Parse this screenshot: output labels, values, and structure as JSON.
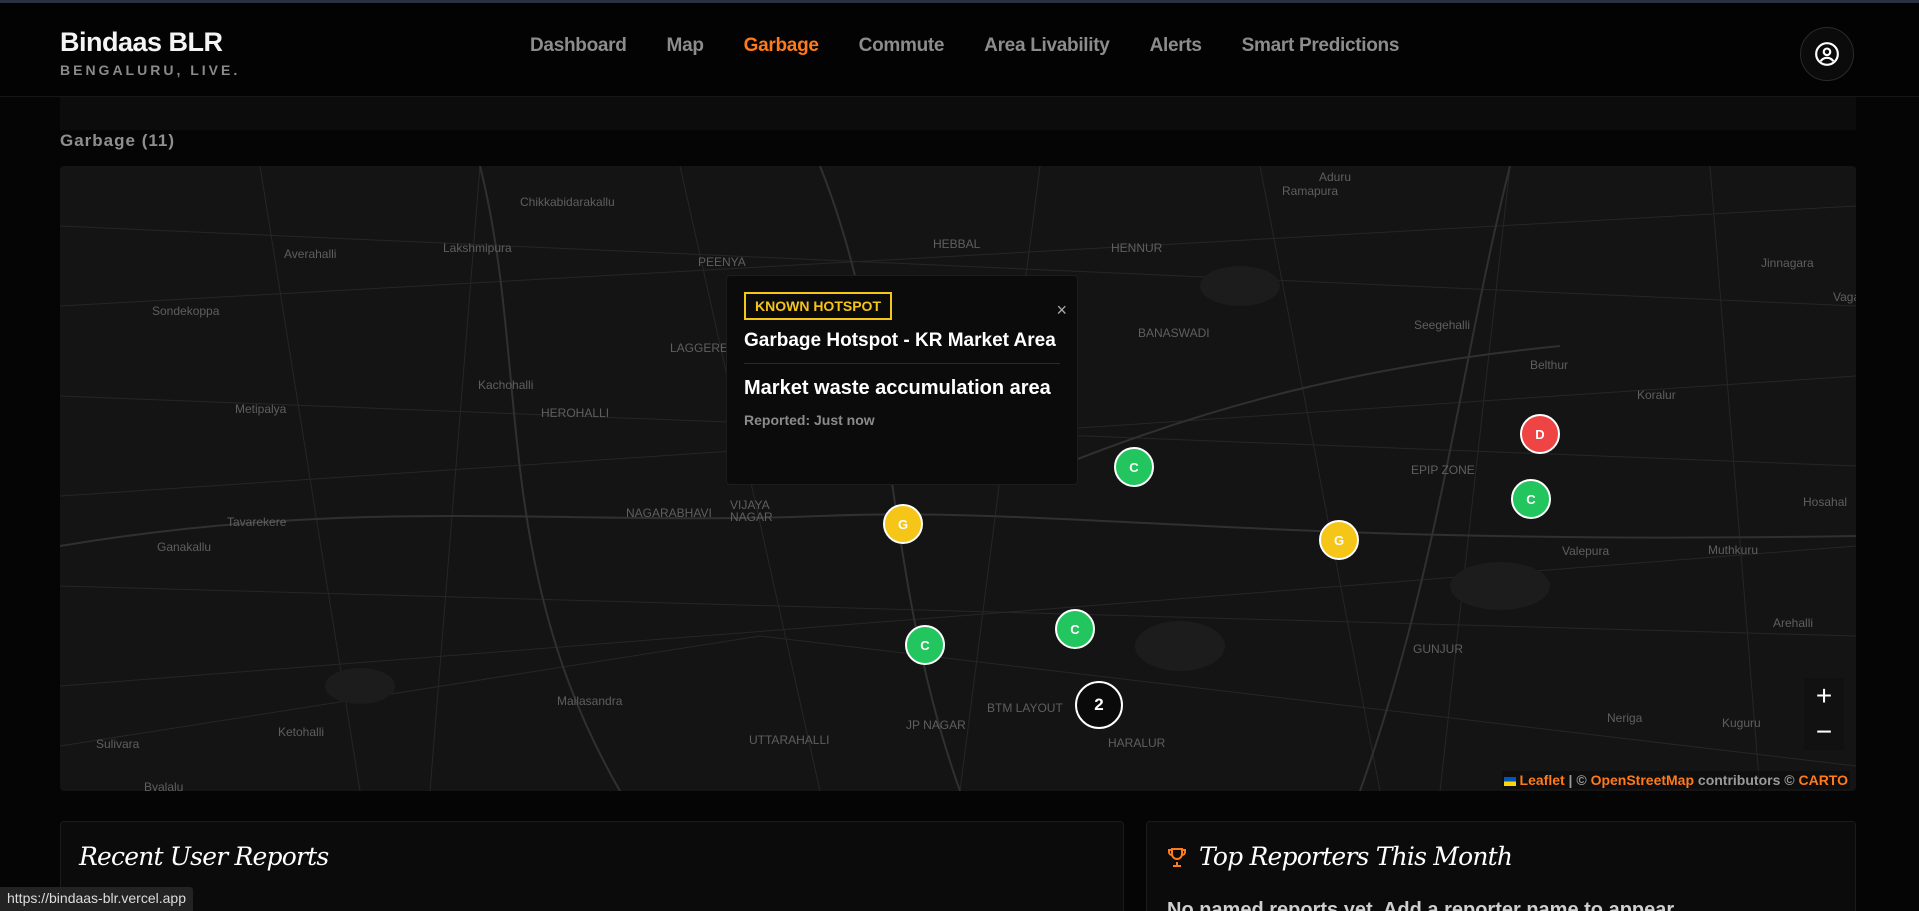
{
  "brand": {
    "title": "Bindaas BLR",
    "subtitle": "BENGALURU, LIVE."
  },
  "nav": [
    "Dashboard",
    "Map",
    "Garbage",
    "Commute",
    "Area Livability",
    "Alerts",
    "Smart Predictions"
  ],
  "nav_active": "Garbage",
  "section": {
    "label": "Garbage (11)"
  },
  "map": {
    "places": [
      "Chikkabidarakallu",
      "Averahalli",
      "Lakshmipura",
      "PEENYA",
      "HEBBAL",
      "HENNUR",
      "Aduru",
      "Ramapura",
      "Jinnagara",
      "Sondekoppa",
      "Vaga",
      "Seegehalli",
      "BANASWADI",
      "Belthur",
      "Kachohalli",
      "HEROHALLI",
      "LAGGERE",
      "Koralur",
      "Metipalya",
      "EPIP ZONE",
      "Hosahal",
      "VIJAYA NAGAR",
      "NAGARABHAVI",
      "Tavarekere",
      "Ganakallu",
      "Valepura",
      "Muthkuru",
      "Arehalli",
      "GUNJUR",
      "Mailasandra",
      "BTM LAYOUT",
      "JP NAGAR",
      "UTTARAHALLI",
      "HARALUR",
      "Neriga",
      "Kuguru",
      "Sulivara",
      "Ketohalli",
      "Byalalu"
    ],
    "markers": [
      {
        "label": "C",
        "status": "green"
      },
      {
        "label": "G",
        "status": "yellow"
      },
      {
        "label": "G",
        "status": "yellow"
      },
      {
        "label": "D",
        "status": "red"
      },
      {
        "label": "C",
        "status": "green"
      },
      {
        "label": "C",
        "status": "green"
      },
      {
        "label": "C",
        "status": "green"
      }
    ],
    "cluster": {
      "count": "2"
    },
    "zoom": {
      "in": "+",
      "out": "−"
    },
    "attribution": {
      "leaflet": "Leaflet",
      "sep": " | © ",
      "osm": "OpenStreetMap",
      "contrib": " contributors © ",
      "carto": "CARTO"
    },
    "popup": {
      "badge": "KNOWN HOTSPOT",
      "title": "Garbage Hotspot - KR Market Area",
      "description": "Market waste accumulation area",
      "time": "Reported: Just now",
      "close": "×"
    }
  },
  "cards": {
    "recent": {
      "title": "Recent User Reports"
    },
    "top": {
      "title": "Top Reporters This Month",
      "text": "No named reports yet. Add a reporter name to appear"
    }
  },
  "status_url": "https://bindaas-blr.vercel.app",
  "colors": {
    "accent": "#ff7a1a",
    "green": "#22c55e",
    "yellow": "#f5c518",
    "red": "#ef4444"
  },
  "icons": [
    "user-circle-icon",
    "trophy-icon",
    "ukraine-flag-icon",
    "close-icon"
  ]
}
